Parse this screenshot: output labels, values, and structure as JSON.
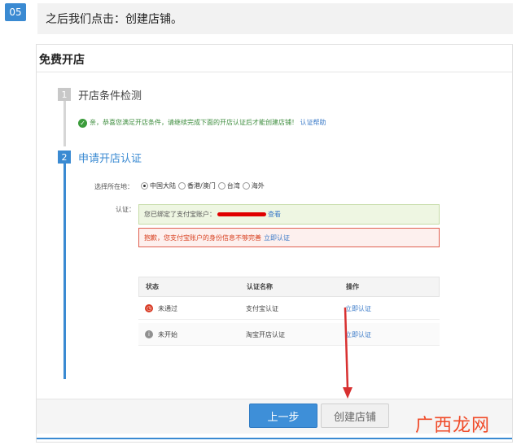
{
  "step_number": "05",
  "instruction": "之后我们点击：创建店铺。",
  "panel": {
    "title": "免费开店",
    "steps": [
      {
        "number": "1",
        "label": "开店条件检测"
      },
      {
        "number": "2",
        "label": "申请开店认证"
      }
    ],
    "condition_message": "亲，恭喜您满足开店条件，请继续完成下面的开店认证后才能创建店铺！",
    "condition_link": "认证帮助",
    "location": {
      "label": "选择所在地：",
      "options": [
        "中国大陆",
        "香港/澳门",
        "台湾",
        "海外"
      ],
      "selected": "中国大陆"
    },
    "auth_label": "认证：",
    "alipay_bound_text": "您已绑定了支付宝账户：",
    "alipay_view_link": "查看",
    "alert_text": "抱歉，您支付宝账户的身份信息不够完善",
    "alert_link": "立即认证",
    "table": {
      "headers": [
        "状态",
        "认证名称",
        "操作"
      ],
      "rows": [
        {
          "status": "未通过",
          "name": "支付宝认证",
          "action": "立即认证"
        },
        {
          "status": "未开始",
          "name": "淘宝开店认证",
          "action": "立即认证"
        }
      ]
    },
    "buttons": {
      "prev": "上一步",
      "create": "创建店铺"
    }
  },
  "watermark": "广西龙网",
  "colors": {
    "accent": "#3a8ad2",
    "alert": "#d84020",
    "success": "#3c9c3c",
    "annotation_arrow": "#d83030"
  }
}
